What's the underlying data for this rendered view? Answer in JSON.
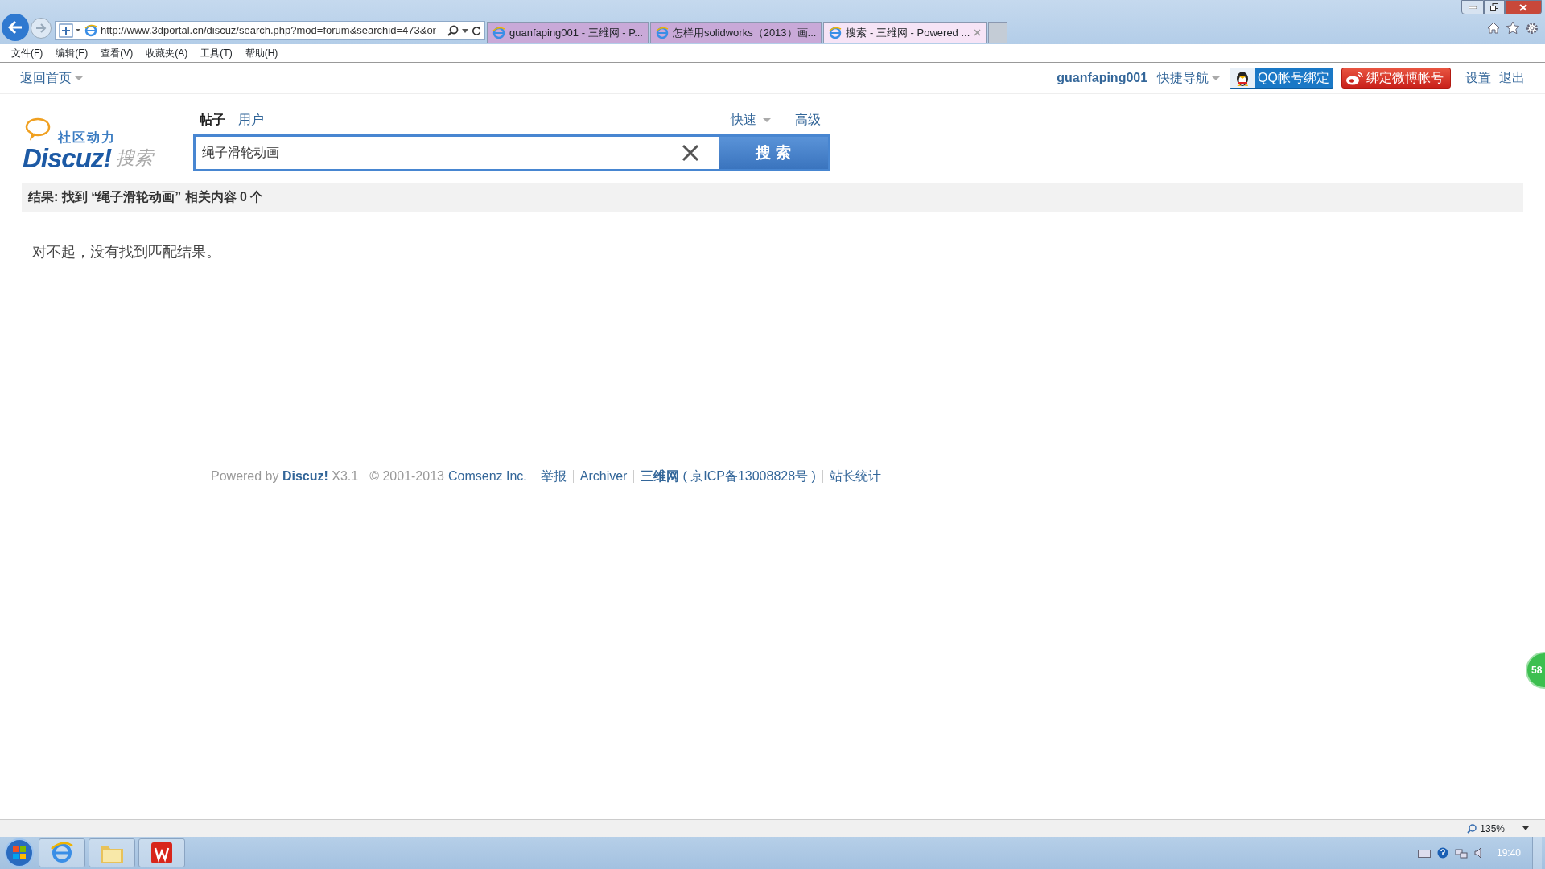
{
  "browser": {
    "address": "http://www.3dportal.cn/discuz/search.php?mod=forum&searchid=473&or",
    "tabs": [
      {
        "title": "guanfaping001 - 三维网 - P...",
        "selected": false
      },
      {
        "title": "怎样用solidworks（2013）画...",
        "selected": false
      },
      {
        "title": "搜索 - 三维网 - Powered ...",
        "selected": true
      }
    ],
    "menu": [
      "文件(F)",
      "编辑(E)",
      "查看(V)",
      "收藏夹(A)",
      "工具(T)",
      "帮助(H)"
    ]
  },
  "topbar": {
    "home": "返回首页",
    "username": "guanfaping001",
    "quick_nav": "快捷导航",
    "qq_bind": "QQ帐号绑定",
    "weibo_bind": "绑定微博帐号",
    "links": [
      "设置",
      "退出"
    ]
  },
  "search": {
    "logo_sub": "社区动力",
    "logo_main": "Discuz!",
    "logo_tag": "搜索",
    "types": [
      {
        "label": "帖子",
        "selected": true
      },
      {
        "label": "用户",
        "selected": false
      }
    ],
    "quick": "快速",
    "advanced": "高级",
    "query": "绳子滑轮动画",
    "button": "搜 索"
  },
  "results": {
    "summary": "结果: 找到 “绳子滑轮动画” 相关内容 0 个",
    "message": "对不起，没有找到匹配结果。"
  },
  "footer": {
    "powered": "Powered by **Discuz!** X3.1",
    "copyright": "© 2001-2013",
    "company": "Comsenz Inc.",
    "links": [
      "举报",
      "Archiver"
    ],
    "site": "三维网",
    "icp": "( 京ICP备13008828号 )",
    "stats": "站长统计"
  },
  "floating_badge": "58",
  "status_bar": {
    "zoom": "135%"
  },
  "taskbar": {
    "clock": "19:40"
  }
}
